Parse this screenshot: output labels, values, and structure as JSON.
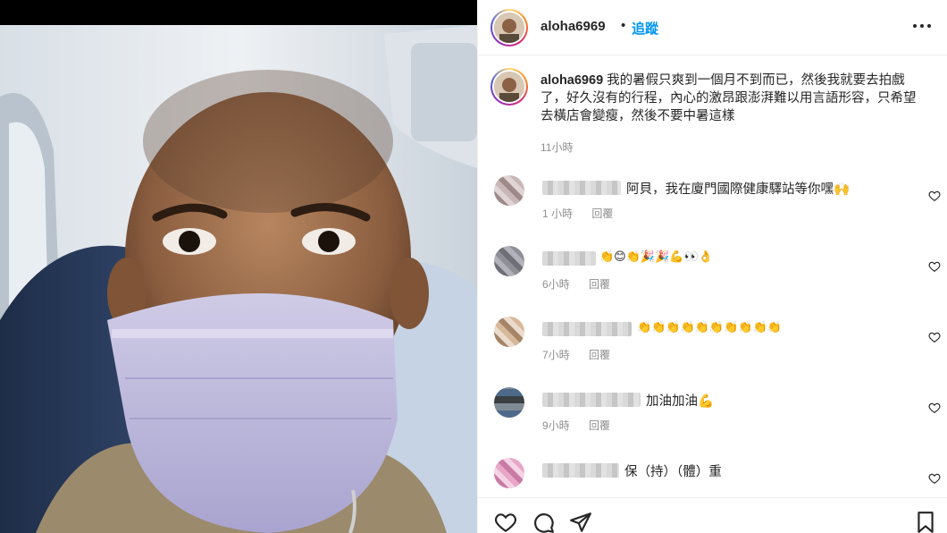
{
  "header": {
    "username": "aloha6969",
    "separator": "•",
    "follow_label": "追蹤",
    "more_icon": "more-horizontal-icon"
  },
  "caption": {
    "username": "aloha6969",
    "text": "我的暑假只爽到一個月不到而已，然後我就要去拍戲了，好久沒有的行程，內心的激昂跟澎湃難以用言語形容，只希望去橫店會變瘦，然後不要中暑這樣",
    "time": "11小時"
  },
  "comments": [
    {
      "text": "阿貝，我在廈門國際健康驛站等你嘿🙌",
      "time": "1 小時",
      "reply": "回覆"
    },
    {
      "text": "👏😊👏🎉🎉💪👀👌",
      "time": "6小時",
      "reply": "回覆"
    },
    {
      "text": "👏👏👏👏👏👏👏👏👏👏",
      "time": "7小時",
      "reply": "回覆"
    },
    {
      "text": "加油加油💪",
      "time": "9小時",
      "reply": "回覆"
    },
    {
      "text": "保（持）（體）重",
      "time": "",
      "reply": ""
    }
  ],
  "actions": {
    "like_icon": "heart-icon",
    "comment_icon": "comment-icon",
    "share_icon": "send-icon",
    "save_icon": "bookmark-icon"
  },
  "colors": {
    "accent_blue": "#0095f6",
    "text_primary": "#262626",
    "text_secondary": "#8e8e8e",
    "border": "#efefef"
  }
}
